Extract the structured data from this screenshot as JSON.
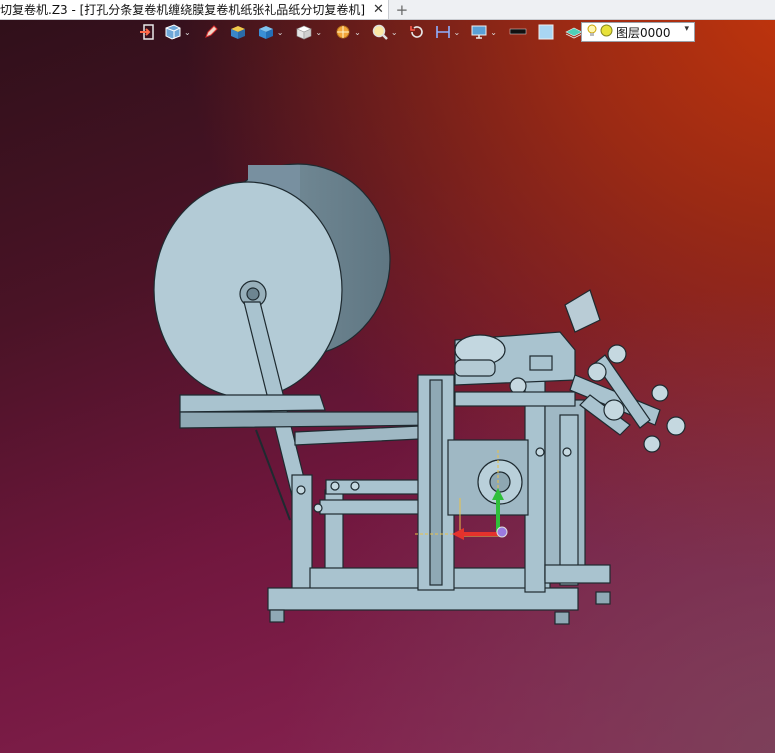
{
  "tab": {
    "title": "切复卷机.Z3 - [打孔分条复卷机缠绕膜复卷机纸张礼品纸分切复卷机]",
    "close": "✕",
    "add": "+"
  },
  "toolbar": {
    "items": [
      "exit-icon",
      "view-orient-icon",
      "pencil-icon",
      "shaded-box-icon",
      "solid-cube-icon",
      "wire-cube-icon",
      "sun-render-icon",
      "zoom-icon",
      "rotate-icon",
      "dimension-icon",
      "display-icon",
      "line-color-swatch",
      "fill-color-swatch",
      "layer-tool-icon"
    ],
    "layer_name": "图层0000",
    "layer_dropdown": "▾"
  },
  "colors": {
    "model": "#a9c3cf",
    "model_edge": "#1e2a30",
    "axis_x": "#e4322c",
    "axis_y": "#2fbf3a",
    "axis_z": "#e9c24a"
  }
}
